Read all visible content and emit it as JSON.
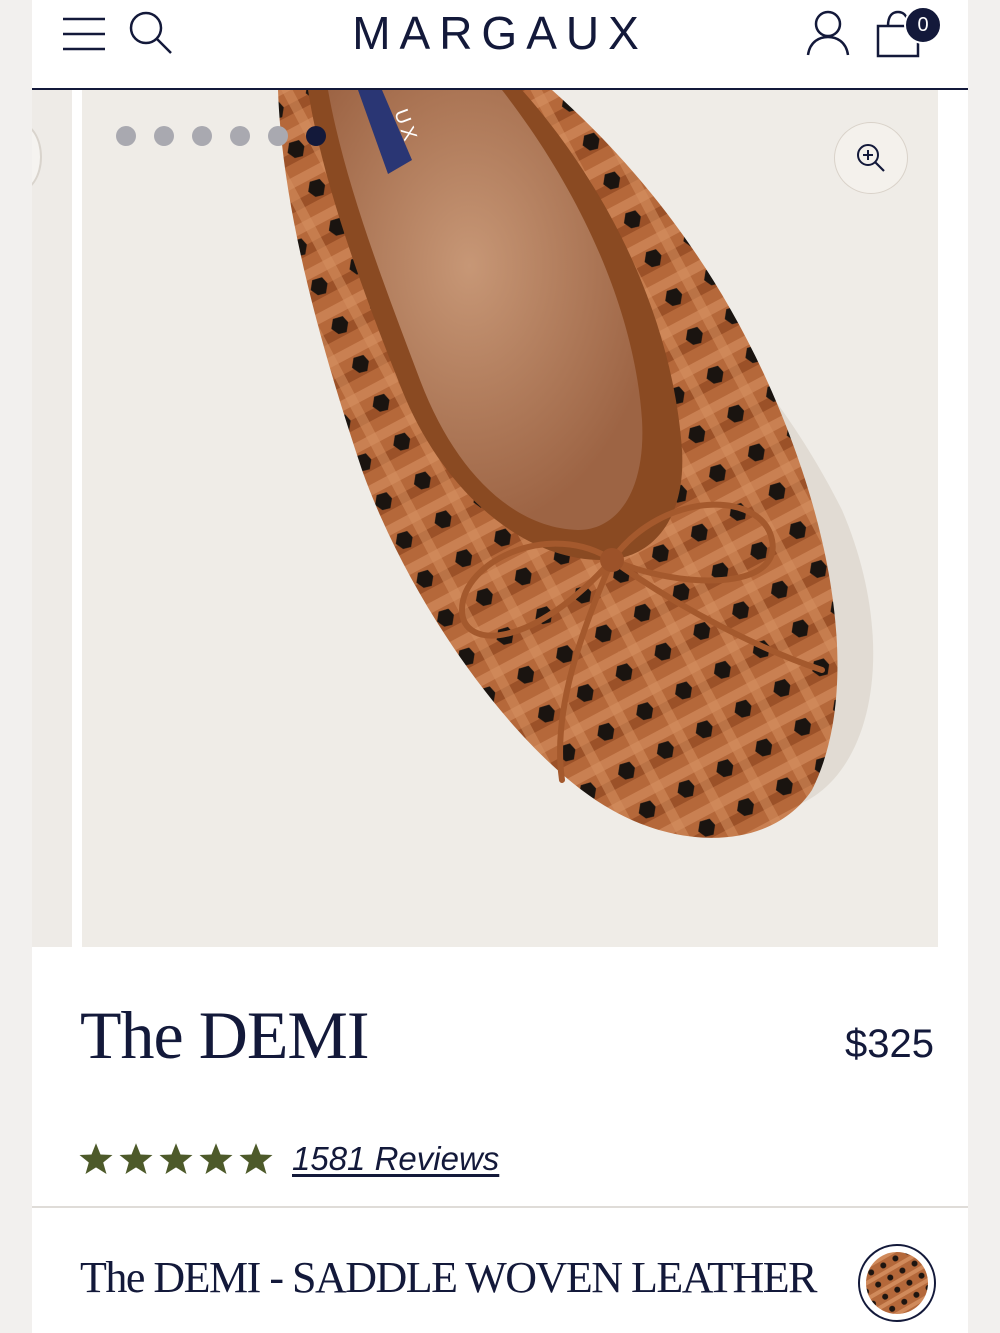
{
  "header": {
    "logo": "MARGAUX",
    "cart_count": "0"
  },
  "gallery": {
    "slide_count": 6,
    "active_slide": 6,
    "insole_label": "UX"
  },
  "product": {
    "title": "The DEMI",
    "price": "$325",
    "rating_stars": 5,
    "reviews_label": "1581 Reviews",
    "variant_title": "The DEMI - SADDLE WOVEN LEATHER"
  },
  "colors": {
    "brand_navy": "#13193a",
    "star_green": "#4d5a2a",
    "leather": "#a8592c"
  }
}
